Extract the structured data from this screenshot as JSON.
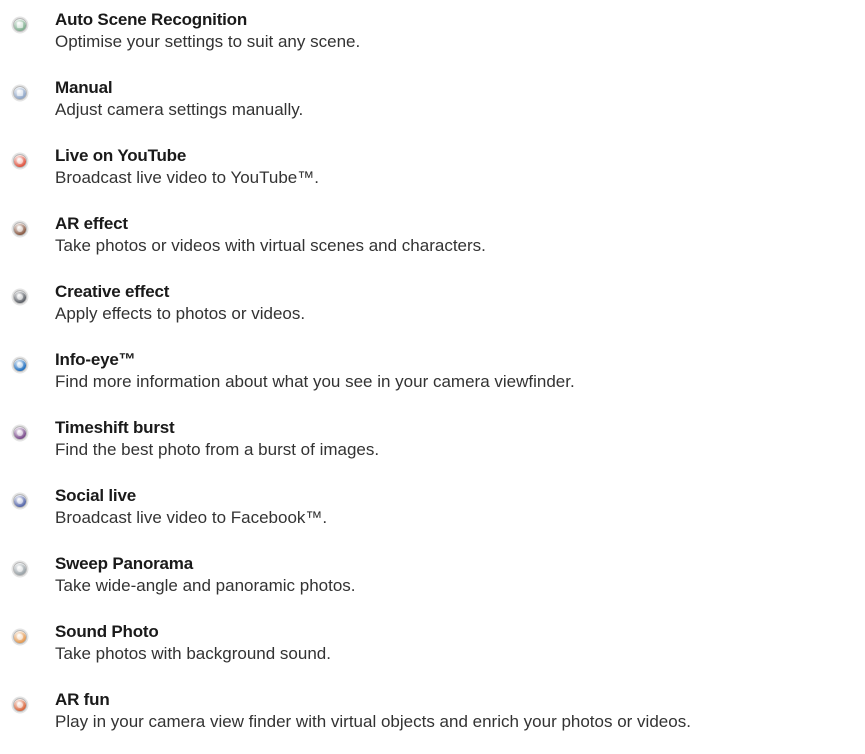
{
  "modes": [
    {
      "title": "Auto Scene Recognition",
      "description": "Optimise your settings to suit any scene.",
      "icon": "scn-auto-icon",
      "icon_color": "#7fae8f"
    },
    {
      "title": "Manual",
      "description": "Adjust camera settings manually.",
      "icon": "manual-m-icon",
      "icon_color": "#8fa6c8"
    },
    {
      "title": "Live on YouTube",
      "description": "Broadcast live video to YouTube™.",
      "icon": "youtube-live-icon",
      "icon_color": "#e0533f"
    },
    {
      "title": "AR effect",
      "description": "Take photos or videos with virtual scenes and characters.",
      "icon": "ar-effect-icon",
      "icon_color": "#8a5a44"
    },
    {
      "title": "Creative effect",
      "description": "Apply effects to photos or videos.",
      "icon": "creative-effect-icon",
      "icon_color": "#5b5f66"
    },
    {
      "title": "Info-eye™",
      "description": "Find more information about what you see in your camera viewfinder.",
      "icon": "info-eye-icon",
      "icon_color": "#1f6fc0"
    },
    {
      "title": "Timeshift burst",
      "description": "Find the best photo from a burst of images.",
      "icon": "timeshift-burst-icon",
      "icon_color": "#7a4a8c"
    },
    {
      "title": "Social live",
      "description": "Broadcast live video to Facebook™.",
      "icon": "social-live-icon",
      "icon_color": "#5566aa"
    },
    {
      "title": "Sweep Panorama",
      "description": "Take wide-angle and panoramic photos.",
      "icon": "sweep-panorama-icon",
      "icon_color": "#9aa3a8"
    },
    {
      "title": "Sound Photo",
      "description": "Take photos with background sound.",
      "icon": "sound-photo-icon",
      "icon_color": "#e59a52"
    },
    {
      "title": "AR fun",
      "description": "Play in your camera view finder with virtual objects and enrich your photos or videos.",
      "icon": "ar-fun-icon",
      "icon_color": "#d9653b"
    }
  ]
}
